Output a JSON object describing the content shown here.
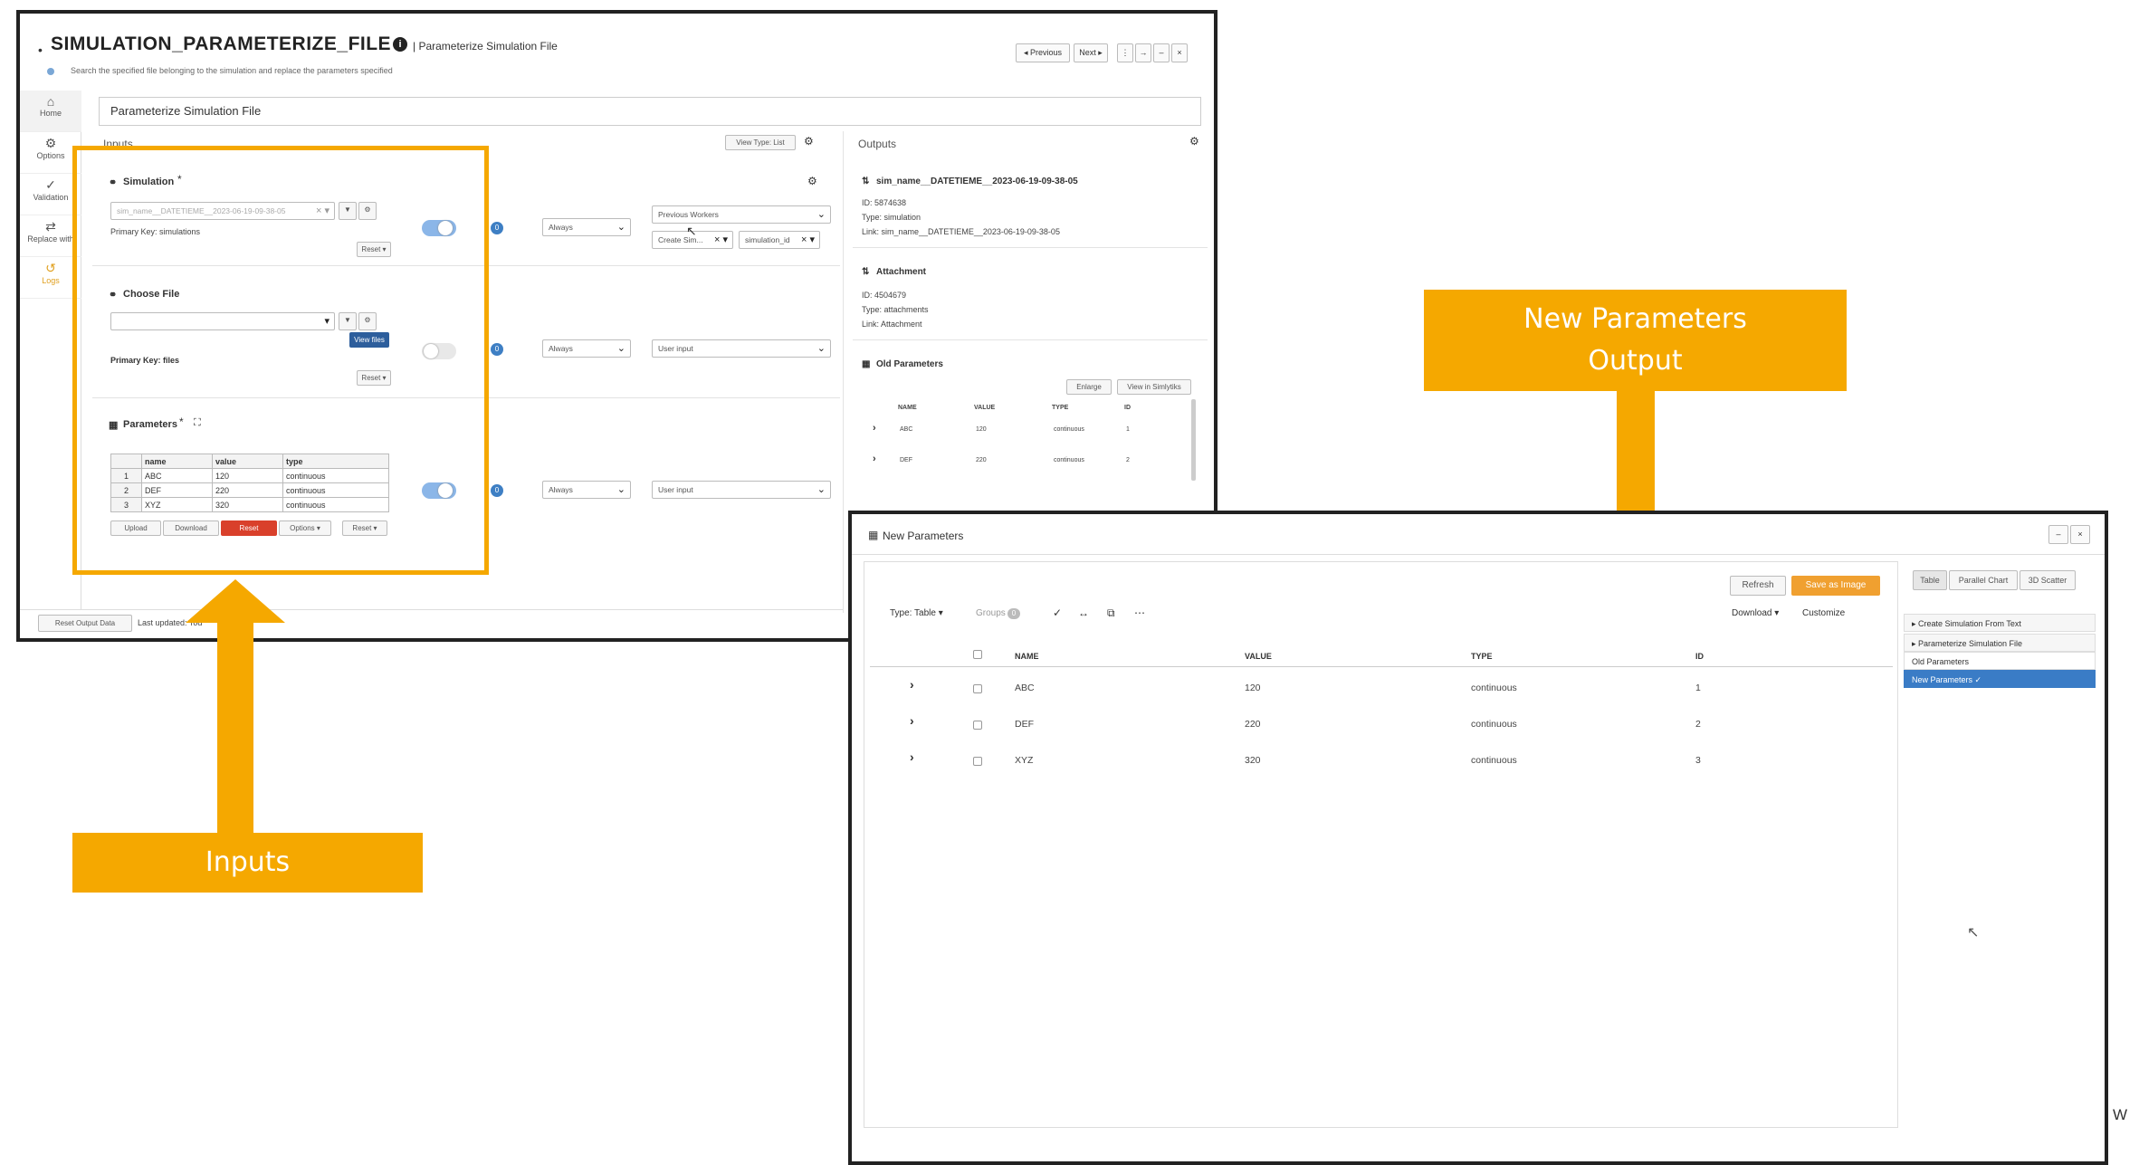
{
  "window1": {
    "app_title": "SIMULATION_PARAMETERIZE_FILE",
    "subtitle": "| Parameterize Simulation File",
    "description": "Search the specified file belonging to the simulation and replace the parameters specified",
    "nav_previous": "◂ Previous",
    "nav_next": "Next ▸",
    "name_value": "Parameterize Simulation File",
    "sidebar": [
      {
        "label": "Home",
        "icon": "home-icon"
      },
      {
        "label": "Options",
        "icon": "gear-icon"
      },
      {
        "label": "Validation",
        "icon": "check-icon"
      },
      {
        "label": "Replace with",
        "icon": "swap-icon"
      },
      {
        "label": "Logs",
        "icon": "history-icon"
      }
    ],
    "inputs_label": "Inputs",
    "view_type": "View Type: List",
    "outputs_label": "Outputs",
    "simulation": {
      "title": "Simulation",
      "value": "sim_name__DATETIEME__2023-06-19-09-38-05",
      "primary_key": "Primary Key: simulations",
      "reset": "Reset ▾",
      "mode": "Always",
      "source": "Previous Workers",
      "create_sim": "Create Sim...",
      "field": "simulation_id"
    },
    "choose_file": {
      "title": "Choose File",
      "view_files": "View files",
      "primary_key": "Primary Key: files",
      "reset": "Reset ▾",
      "mode": "Always",
      "source": "User input"
    },
    "parameters": {
      "title": "Parameters",
      "columns": [
        "name",
        "value",
        "type"
      ],
      "rows": [
        [
          "1",
          "ABC",
          "120",
          "continuous"
        ],
        [
          "2",
          "DEF",
          "220",
          "continuous"
        ],
        [
          "3",
          "XYZ",
          "320",
          "continuous"
        ]
      ],
      "buttons": [
        "Upload",
        "Download",
        "Reset",
        "Options ▾",
        "Reset ▾"
      ],
      "mode": "Always",
      "source": "User input"
    },
    "outputs": {
      "sim_title": "sim_name__DATETIEME__2023-06-19-09-38-05",
      "sim_id": "ID: 5874638",
      "sim_type": "Type: simulation",
      "sim_link": "Link: sim_name__DATETIEME__2023-06-19-09-38-05",
      "att_title": "Attachment",
      "att_id": "ID: 4504679",
      "att_type": "Type: attachments",
      "att_link": "Link: Attachment",
      "old_title": "Old Parameters",
      "enlarge": "Enlarge",
      "view_simlytiks": "View in Simlytiks",
      "old_columns": [
        "NAME",
        "VALUE",
        "TYPE",
        "ID"
      ],
      "old_rows": [
        [
          "ABC",
          "120",
          "continuous",
          "1"
        ],
        [
          "DEF",
          "220",
          "continuous",
          "2"
        ]
      ]
    },
    "reset_output": "Reset Output Data",
    "last_updated": "Last updated: Tod"
  },
  "window2": {
    "title": "New Parameters",
    "refresh": "Refresh",
    "save_image": "Save as Image",
    "type_table": "Type: Table ▾",
    "groups": "Groups",
    "groups_count": "0",
    "download": "Download ▾",
    "customize": "Customize",
    "columns": [
      "NAME",
      "VALUE",
      "TYPE",
      "ID"
    ],
    "rows": [
      [
        "ABC",
        "120",
        "continuous",
        "1"
      ],
      [
        "DEF",
        "220",
        "continuous",
        "2"
      ],
      [
        "XYZ",
        "320",
        "continuous",
        "3"
      ]
    ],
    "view_tabs": [
      "Table",
      "Parallel Chart",
      "3D Scatter"
    ],
    "tree": [
      "▸ Create Simulation From Text",
      "▸ Parameterize Simulation File",
      "Old Parameters",
      "New Parameters ✓"
    ]
  },
  "annotations": {
    "inputs_label": "Inputs",
    "output_label_line1": "New Parameters",
    "output_label_line2": "Output",
    "edge_letter": "W"
  },
  "colors": {
    "orange": "#F5A800",
    "blue": "#3e7fc4",
    "red": "#d9402b",
    "selected": "#3a7cc6"
  }
}
